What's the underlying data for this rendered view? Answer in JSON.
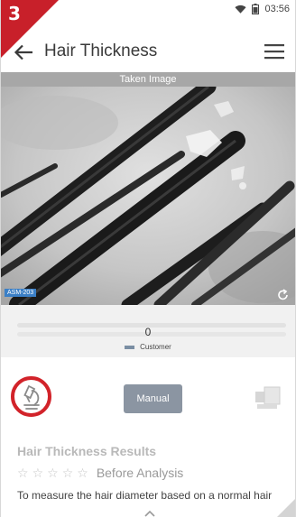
{
  "step_badge": "3",
  "status_bar": {
    "time": "03:56"
  },
  "app_bar": {
    "title": "Hair Thickness"
  },
  "image_section": {
    "header": "Taken Image",
    "device_tag": "ASM-203"
  },
  "result_gauge": {
    "value": "0",
    "legend_label": "Customer",
    "legend_color": "#7a8ea3"
  },
  "actions": {
    "manual_label": "Manual"
  },
  "results": {
    "title": "Hair Thickness Results",
    "rating_stars": 0,
    "rating_label": "Before Analysis",
    "description": "To measure the hair diameter based on a normal hair"
  },
  "colors": {
    "highlight": "#d2232a",
    "badge": "#c8202a",
    "button": "#8b95a2"
  },
  "icons": [
    "wifi-icon",
    "battery-icon",
    "back-arrow-icon",
    "hamburger-menu-icon",
    "rotate-icon",
    "microscope-icon",
    "compare-icon",
    "chevron-up-icon"
  ]
}
